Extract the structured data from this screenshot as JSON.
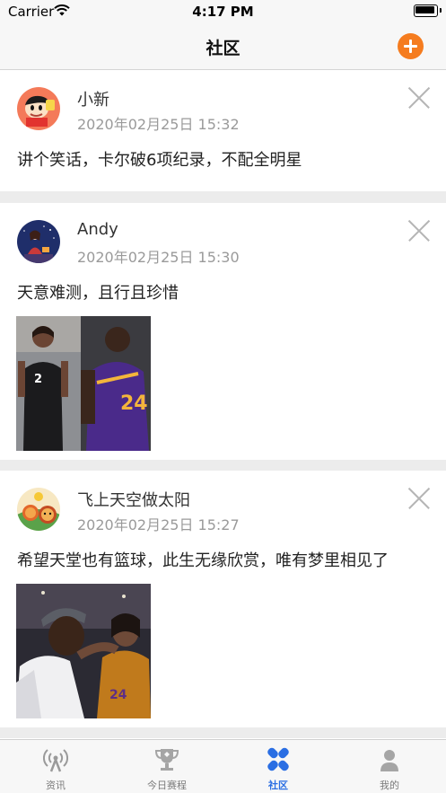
{
  "status_bar": {
    "carrier": "Carrier",
    "time": "4:17 PM"
  },
  "nav": {
    "title": "社区"
  },
  "posts": [
    {
      "username": "小新",
      "time": "2020年02月25日 15:32",
      "content": "讲个笑话，卡尔破6项纪录，不配全明星"
    },
    {
      "username": "Andy",
      "time": "2020年02月25日 15:30",
      "content": "天意难测，且行且珍惜"
    },
    {
      "username": "飞上天空做太阳",
      "time": "2020年02月25日 15:27",
      "content": "希望天堂也有篮球，此生无缘欣赏，唯有梦里相见了"
    }
  ],
  "tab_bar": {
    "items": [
      {
        "label": "资讯",
        "icon": "antenna-icon"
      },
      {
        "label": "今日赛程",
        "icon": "trophy-icon"
      },
      {
        "label": "社区",
        "icon": "community-icon",
        "active": true
      },
      {
        "label": "我的",
        "icon": "person-icon"
      }
    ]
  },
  "colors": {
    "accent_orange": "#f57c1f",
    "tab_active_blue": "#2a6ee3"
  }
}
